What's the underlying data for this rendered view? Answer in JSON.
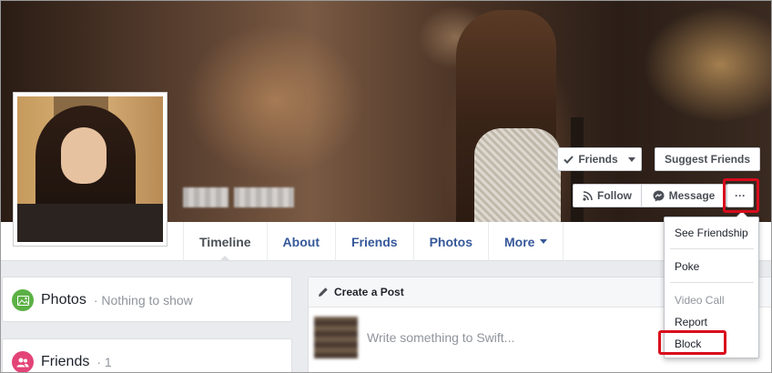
{
  "profile": {
    "name_redacted": "Swift"
  },
  "cover_actions": {
    "friends_label": "Friends",
    "suggest_label": "Suggest Friends",
    "follow_label": "Follow",
    "message_label": "Message",
    "more_label": "···"
  },
  "tabs": [
    {
      "label": "Timeline"
    },
    {
      "label": "About"
    },
    {
      "label": "Friends"
    },
    {
      "label": "Photos"
    },
    {
      "label": "More"
    }
  ],
  "dropdown": {
    "items": [
      "See Friendship",
      "Poke",
      "Video Call",
      "Report",
      "Block"
    ]
  },
  "left": {
    "photos_title": "Photos",
    "photos_sub": "· Nothing to show",
    "friends_title": "Friends",
    "friends_count": "· 1"
  },
  "post": {
    "header": "Create a Post",
    "placeholder": "Write something to Swift..."
  },
  "colors": {
    "link_blue": "#365899",
    "highlight_red": "#d90b1c",
    "photos_green": "#5bb145",
    "friends_pink": "#e34478"
  },
  "icons": [
    "check-icon",
    "caret-down-icon",
    "rss-icon",
    "messenger-icon",
    "ellipsis-icon",
    "photos-icon",
    "friends-icon",
    "pencil-icon"
  ]
}
